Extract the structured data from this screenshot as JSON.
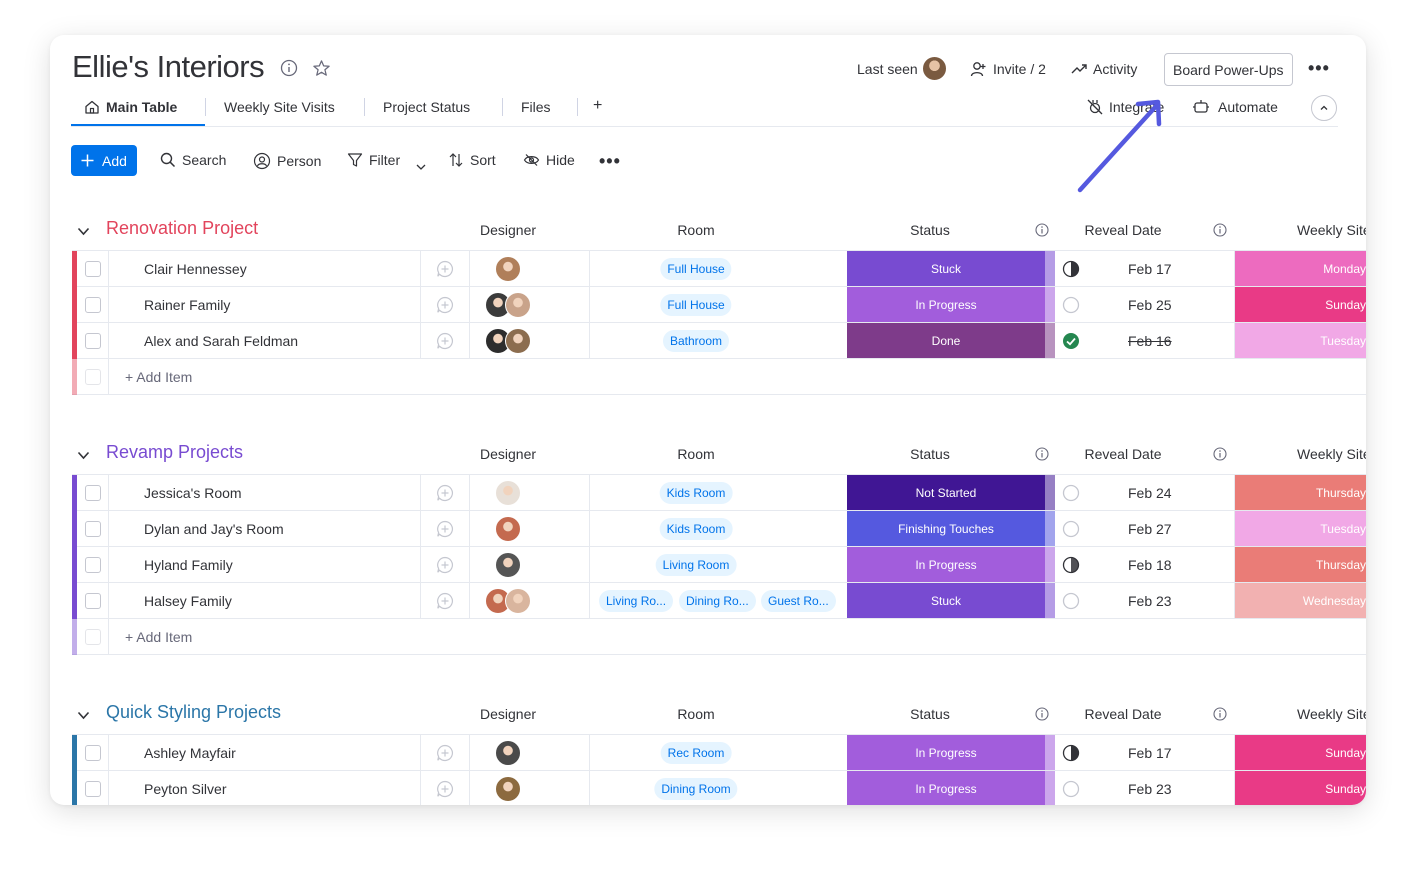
{
  "board": {
    "title": "Ellie's Interiors",
    "last_seen_label": "Last seen",
    "invite_label": "Invite / 2",
    "activity_label": "Activity",
    "power_ups_label": "Board Power-Ups",
    "integrate_label": "Integrate",
    "automate_label": "Automate"
  },
  "tabs": [
    {
      "label": "Main Table"
    },
    {
      "label": "Weekly Site Visits"
    },
    {
      "label": "Project Status"
    },
    {
      "label": "Files"
    },
    {
      "label": "+"
    }
  ],
  "toolbar": {
    "add_label": "Add",
    "search_label": "Search",
    "person_label": "Person",
    "filter_label": "Filter",
    "sort_label": "Sort",
    "hide_label": "Hide"
  },
  "columns": {
    "designer": "Designer",
    "room": "Room",
    "status": "Status",
    "reveal_date": "Reveal Date",
    "weekly_site": "Weekly Site"
  },
  "colors": {
    "accent": "#0073ea",
    "annotation_arrow": "#5559df"
  },
  "groups": [
    {
      "title": "Renovation Project",
      "color": "#e2445c",
      "title_color": "#e2445c",
      "add_item_label": "+ Add Item",
      "rows": [
        {
          "name": "Clair Hennessey",
          "rooms": [
            "Full House"
          ],
          "status": "Stuck",
          "status_color": "#784bd1",
          "progress": "half",
          "reveal": "Feb 17",
          "done": false,
          "weekly": "Monday",
          "weekly_color": "#ed6bbf",
          "avatars": [
            "#b07f5a"
          ]
        },
        {
          "name": "Rainer Family",
          "rooms": [
            "Full House"
          ],
          "status": "In Progress",
          "status_color": "#a25ddc",
          "progress": "empty",
          "reveal": "Feb 25",
          "done": false,
          "weekly": "Sunday",
          "weekly_color": "#e93a86",
          "avatars": [
            "#3b3b3b",
            "#c9a38a"
          ]
        },
        {
          "name": "Alex and Sarah Feldman",
          "rooms": [
            "Bathroom"
          ],
          "status": "Done",
          "status_color": "#7e3b8a",
          "progress": "done",
          "reveal": "Feb 16",
          "done": true,
          "weekly": "Tuesday",
          "weekly_color": "#f1a8e6",
          "avatars": [
            "#2d2d2d",
            "#8c6d4f"
          ]
        }
      ]
    },
    {
      "title": "Revamp Projects",
      "color": "#784bd1",
      "title_color": "#784bd1",
      "add_item_label": "+ Add Item",
      "rows": [
        {
          "name": "Jessica's Room",
          "rooms": [
            "Kids Room"
          ],
          "status": "Not Started",
          "status_color": "#401694",
          "progress": "empty",
          "reveal": "Feb 24",
          "done": false,
          "weekly": "Thursday",
          "weekly_color": "#ea7c77",
          "avatars": [
            "#e8e0d8"
          ]
        },
        {
          "name": "Dylan and Jay's Room",
          "rooms": [
            "Kids Room"
          ],
          "status": "Finishing Touches",
          "status_color": "#5559df",
          "progress": "empty",
          "reveal": "Feb 27",
          "done": false,
          "weekly": "Tuesday",
          "weekly_color": "#f1a8e6",
          "avatars": [
            "#c46a4f"
          ]
        },
        {
          "name": "Hyland Family",
          "rooms": [
            "Living Room"
          ],
          "status": "In Progress",
          "status_color": "#a25ddc",
          "progress": "quarter",
          "reveal": "Feb 18",
          "done": false,
          "weekly": "Thursday",
          "weekly_color": "#ea7c77",
          "avatars": [
            "#555555"
          ]
        },
        {
          "name": "Halsey Family",
          "rooms": [
            "Living Ro...",
            "Dining Ro...",
            "Guest Ro..."
          ],
          "status": "Stuck",
          "status_color": "#784bd1",
          "progress": "empty",
          "reveal": "Feb 23",
          "done": false,
          "weekly": "Wednesday",
          "weekly_color": "#f2b1b1",
          "avatars": [
            "#c46a4f",
            "#d9b59e"
          ]
        }
      ]
    },
    {
      "title": "Quick Styling Projects",
      "color": "#2b76a8",
      "title_color": "#2b76a8",
      "add_item_label": "",
      "rows": [
        {
          "name": "Ashley Mayfair",
          "rooms": [
            "Rec Room"
          ],
          "status": "In Progress",
          "status_color": "#a25ddc",
          "progress": "half",
          "reveal": "Feb 17",
          "done": false,
          "weekly": "Sunday",
          "weekly_color": "#e93a86",
          "avatars": [
            "#4a4a4a"
          ]
        },
        {
          "name": "Peyton Silver",
          "rooms": [
            "Dining Room"
          ],
          "status": "In Progress",
          "status_color": "#a25ddc",
          "progress": "empty",
          "reveal": "Feb 23",
          "done": false,
          "weekly": "Sunday",
          "weekly_color": "#e93a86",
          "avatars": [
            "#8c6a3f"
          ]
        }
      ]
    }
  ]
}
